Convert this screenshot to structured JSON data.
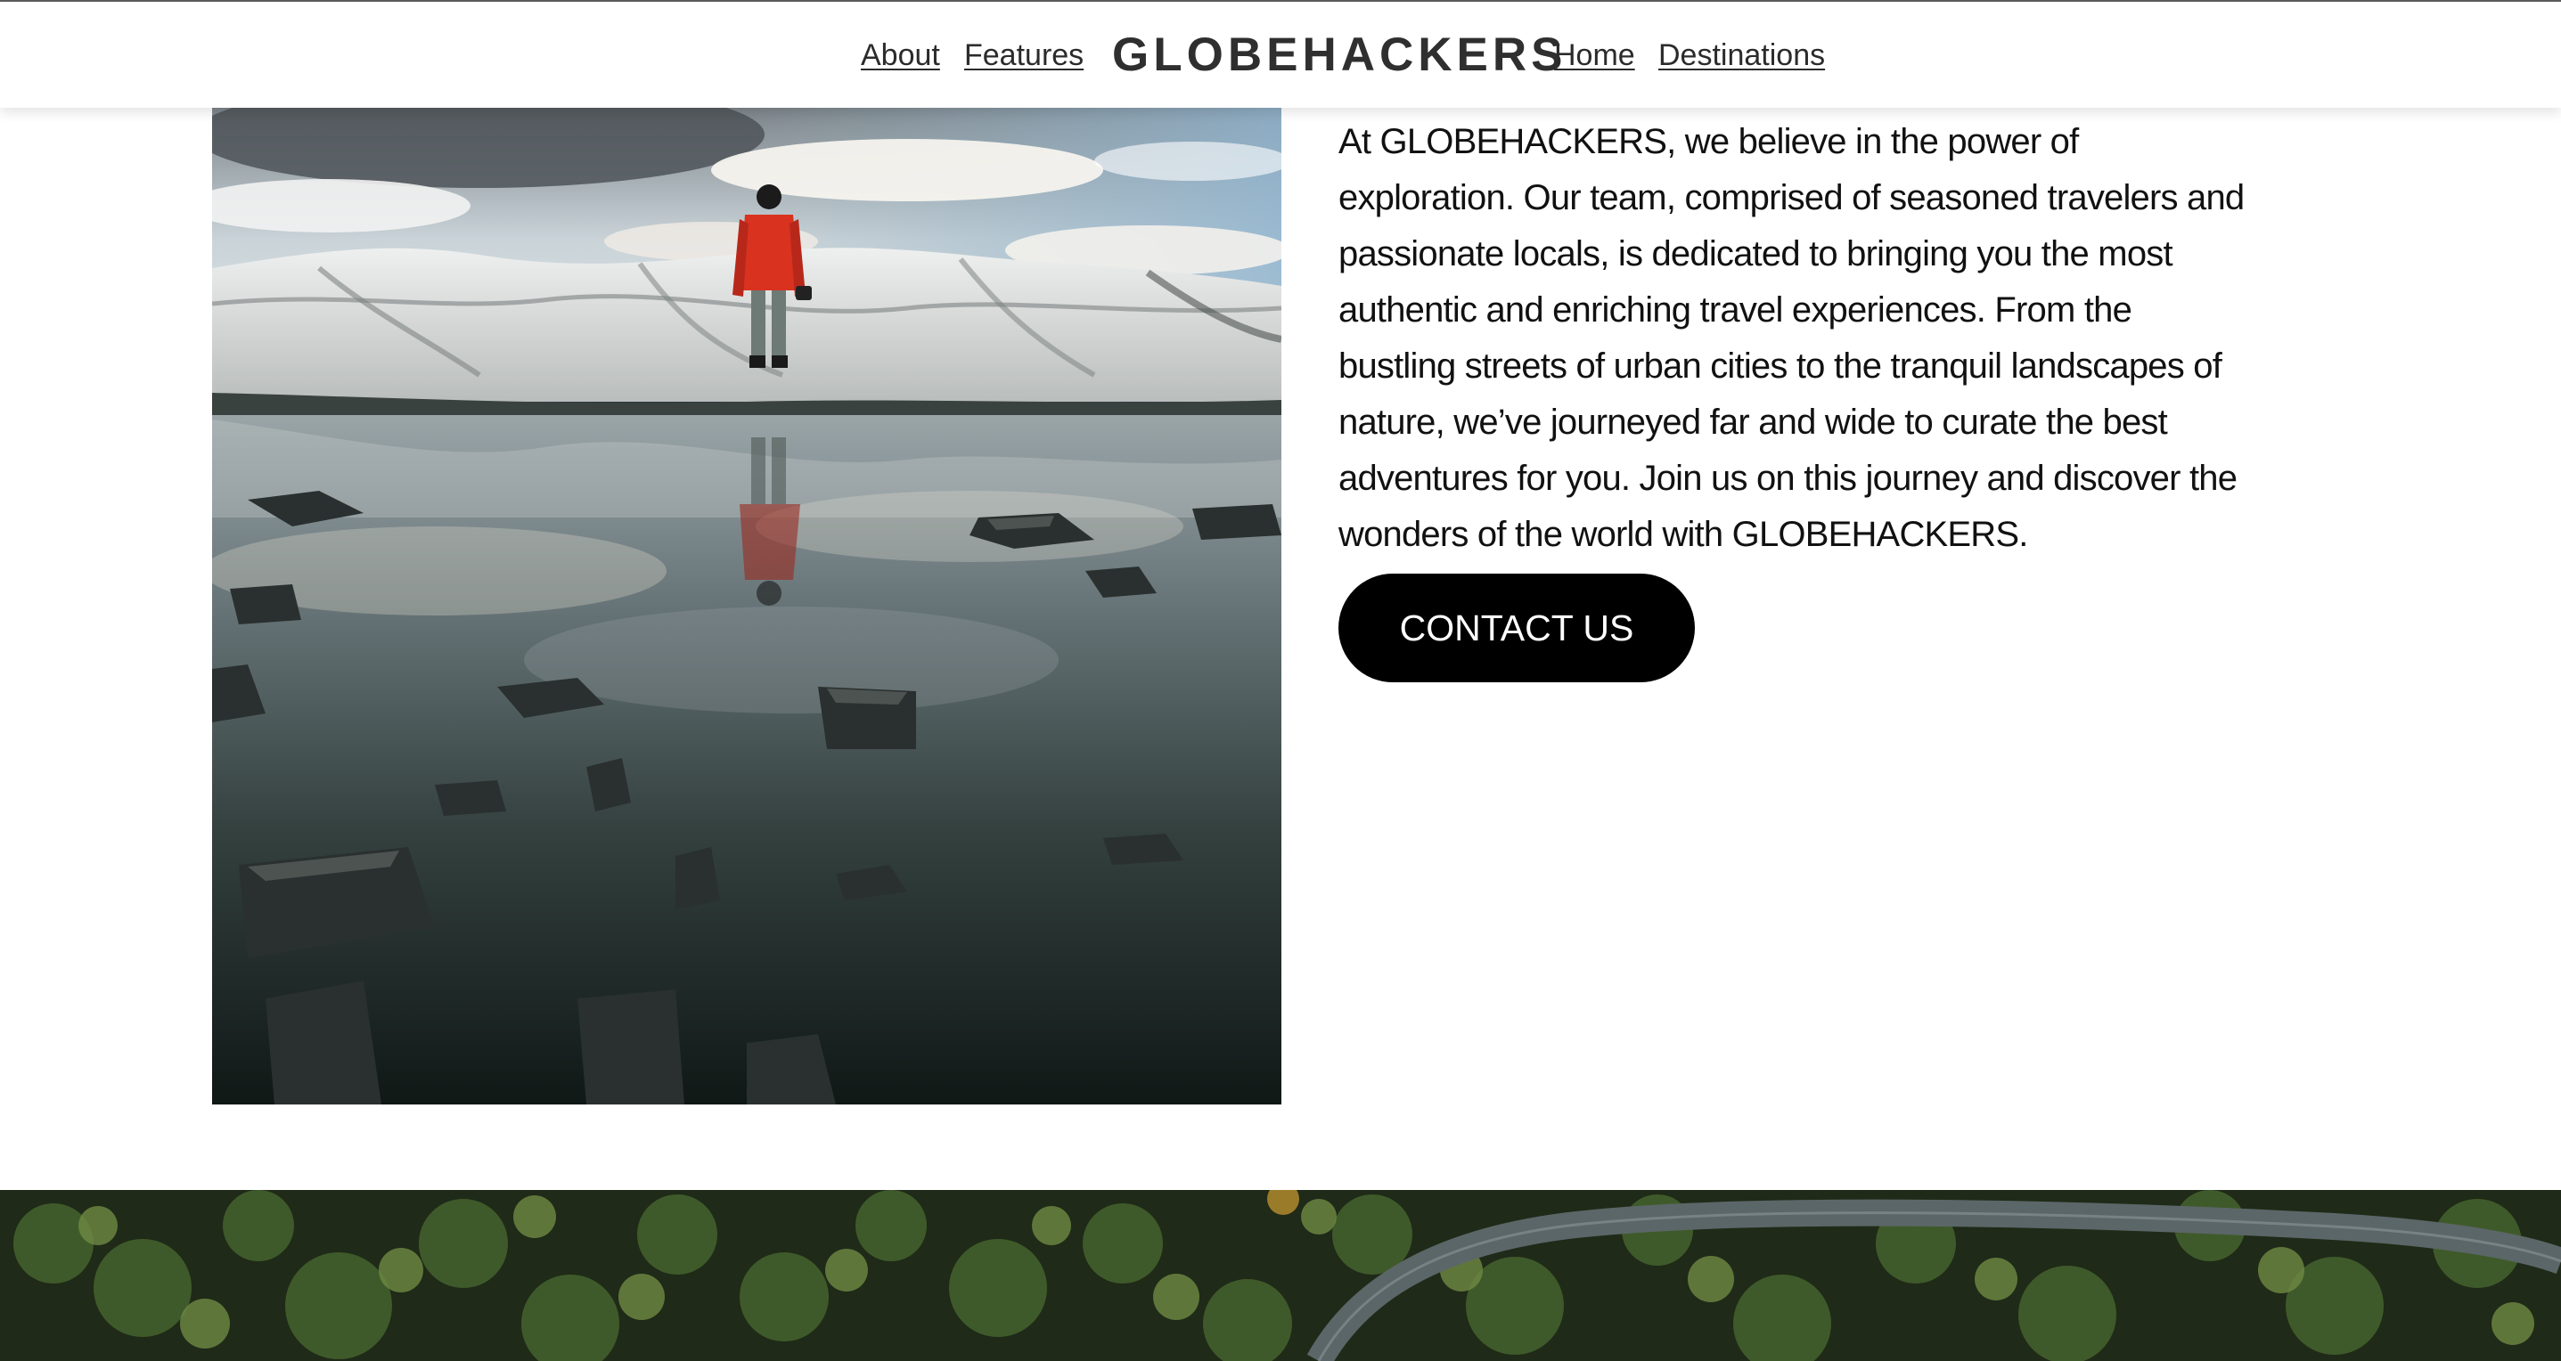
{
  "header": {
    "nav_left": [
      {
        "label": "About"
      },
      {
        "label": "Features"
      }
    ],
    "brand": "GLOBEHACKERS",
    "nav_right": [
      {
        "label": "Home"
      },
      {
        "label": "Destinations"
      }
    ]
  },
  "about": {
    "paragraph": "At GLOBEHACKERS, we believe in the power of exploration. Our team, comprised of seasoned travelers and passionate locals, is dedicated to bringing you the most authentic and enriching travel experiences. From the bustling streets of urban cities to the tranquil landscapes of nature, we’ve journeyed far and wide to curate the best adventures for you. Join us on this journey and discover the wonders of the world with GLOBEHACKERS.",
    "cta_label": "CONTACT US"
  },
  "images": {
    "hero": "traveler-on-glacier-photo",
    "band": "forest-road-aerial-photo"
  },
  "colors": {
    "text": "#111111",
    "button_bg": "#000000",
    "button_text": "#ffffff",
    "jacket": "#d9321f"
  }
}
